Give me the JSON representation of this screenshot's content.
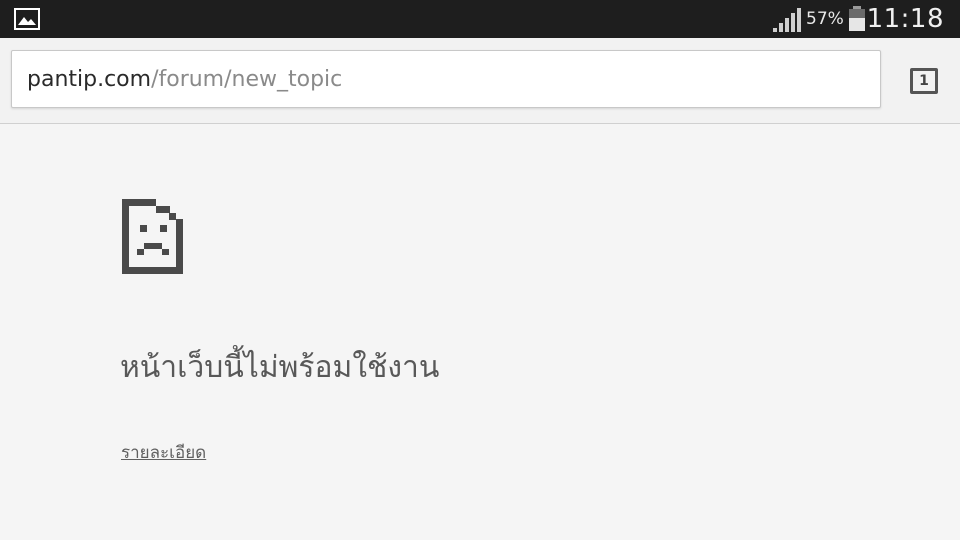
{
  "status_bar": {
    "left_icon": "gallery-icon",
    "signal_icon": "signal-strength-icon",
    "battery_percent": "57%",
    "battery_icon": "battery-icon",
    "time": "11:18",
    "background": "#1e1e1e"
  },
  "toolbar": {
    "url_host": "pantip.com",
    "url_path": "/forum/new_topic",
    "tab_count": "1"
  },
  "error_page": {
    "icon": "sad-page-icon",
    "title": "หน้าเว็บนี้ไม่พร้อมใช้งาน",
    "details_link": "รายละเอียด"
  }
}
